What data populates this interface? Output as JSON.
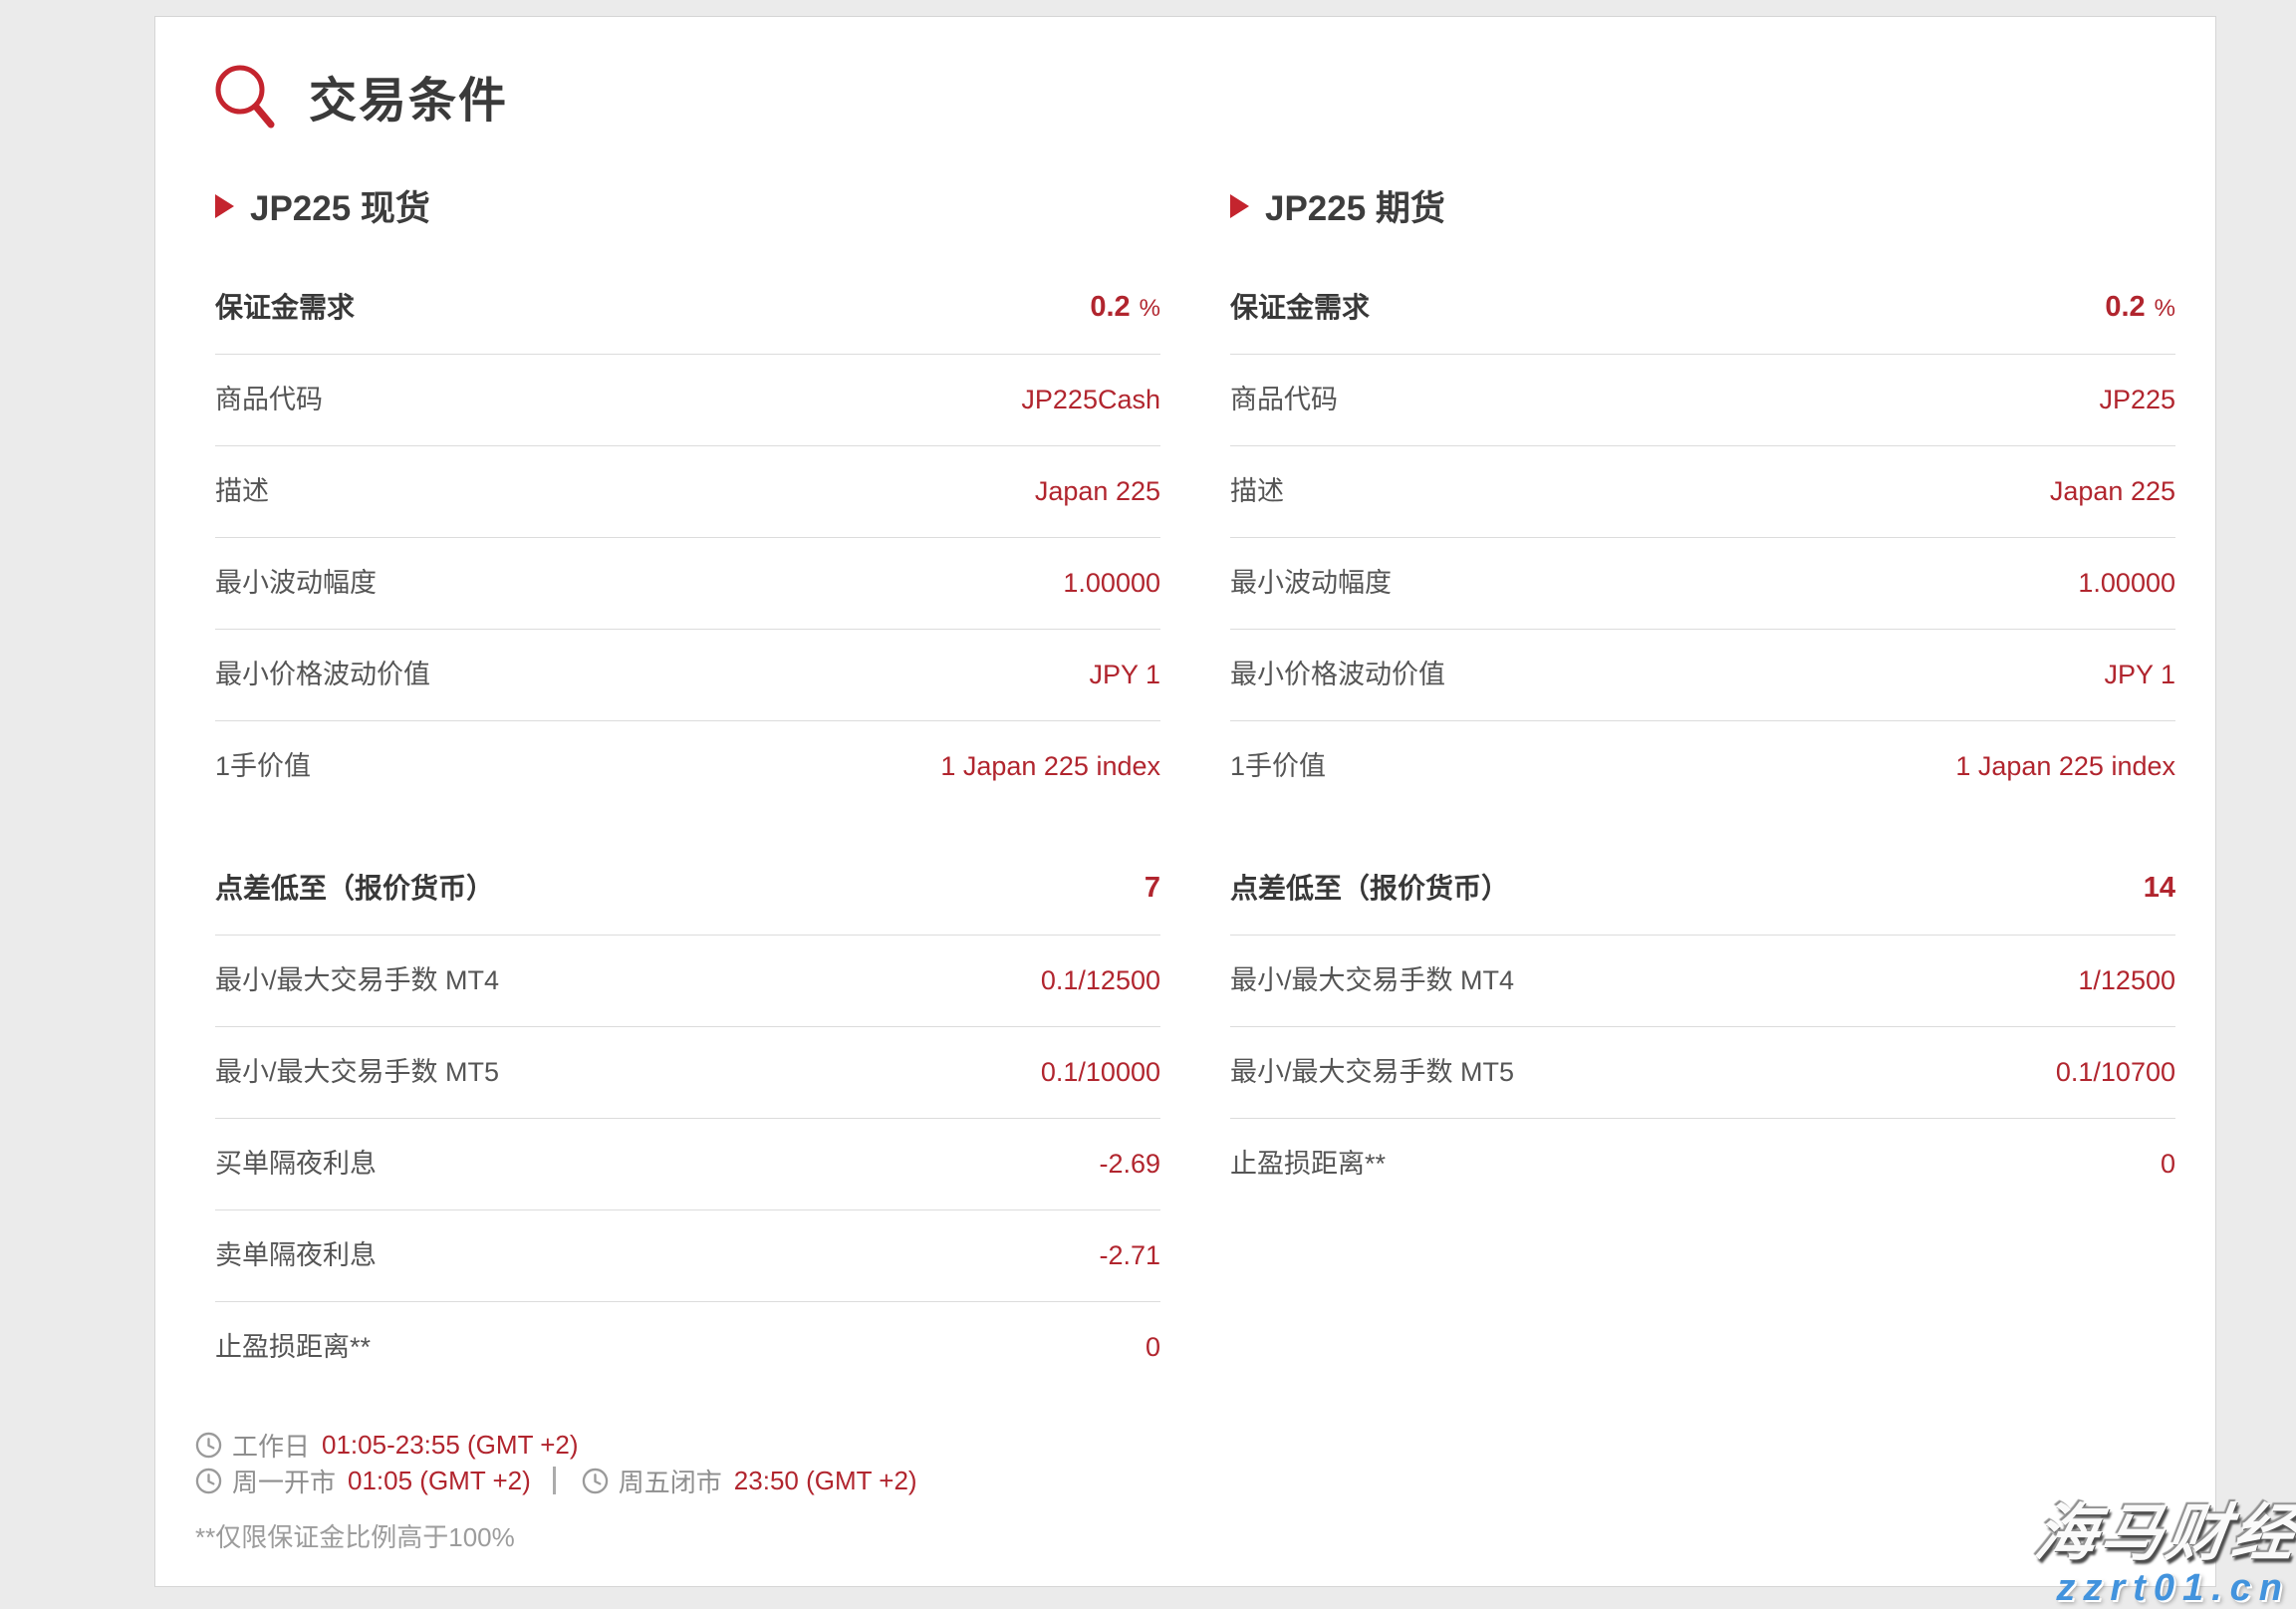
{
  "header": {
    "title": "交易条件",
    "icon": "magnifier-icon"
  },
  "columns": [
    {
      "header": "JP225 现货",
      "bullet_icon": "triangle-bullet-icon",
      "groups": [
        {
          "rows": [
            {
              "label": "保证金需求",
              "value": "0.2",
              "suffix": "%",
              "emph": true
            },
            {
              "label": "商品代码",
              "value": "JP225Cash"
            },
            {
              "label": "描述",
              "value": "Japan 225"
            },
            {
              "label": "最小波动幅度",
              "value": "1.00000"
            },
            {
              "label": "最小价格波动价值",
              "value": "JPY 1"
            },
            {
              "label": "1手价值",
              "value": "1 Japan 225 index"
            }
          ]
        },
        {
          "rows": [
            {
              "label": "点差低至（报价货币）",
              "value": "7",
              "emph": true
            },
            {
              "label": "最小/最大交易手数 MT4",
              "value": "0.1/12500"
            },
            {
              "label": "最小/最大交易手数 MT5",
              "value": "0.1/10000"
            },
            {
              "label": "买单隔夜利息",
              "value": "-2.69"
            },
            {
              "label": "卖单隔夜利息",
              "value": "-2.71"
            },
            {
              "label": "止盈损距离**",
              "value": "0"
            }
          ]
        }
      ]
    },
    {
      "header": "JP225 期货",
      "bullet_icon": "triangle-bullet-icon",
      "groups": [
        {
          "rows": [
            {
              "label": "保证金需求",
              "value": "0.2",
              "suffix": "%",
              "emph": true
            },
            {
              "label": "商品代码",
              "value": "JP225"
            },
            {
              "label": "描述",
              "value": "Japan 225"
            },
            {
              "label": "最小波动幅度",
              "value": "1.00000"
            },
            {
              "label": "最小价格波动价值",
              "value": "JPY 1"
            },
            {
              "label": "1手价值",
              "value": "1 Japan 225 index"
            }
          ]
        },
        {
          "rows": [
            {
              "label": "点差低至（报价货币）",
              "value": "14",
              "emph": true
            },
            {
              "label": "最小/最大交易手数 MT4",
              "value": "1/12500"
            },
            {
              "label": "最小/最大交易手数 MT5",
              "value": "0.1/10700"
            },
            {
              "label": "止盈损距离**",
              "value": "0"
            }
          ]
        }
      ]
    }
  ],
  "footer": {
    "clock_icon": "clock-icon",
    "workday_label": "工作日",
    "workday_time": "01:05-23:55 (GMT +2)",
    "monday_open_label": "周一开市",
    "monday_open_time": "01:05 (GMT +2)",
    "friday_close_label": "周五闭市",
    "friday_close_time": "23:50 (GMT +2)",
    "footnote": "**仅限保证金比例高于100%"
  },
  "watermark": {
    "brand": "海马财经",
    "site": "zzrt01.cn"
  },
  "colors": {
    "value_red": "#b1252e",
    "icon_red": "#c4242e",
    "title_gray": "#3a3a3a",
    "label_gray": "#555555",
    "footer_gray": "#8e8e8e",
    "watermark_blue": "#4293dd",
    "page_bg": "#ebebeb",
    "card_bg": "#ffffff",
    "row_border": "#dcdcdc"
  }
}
